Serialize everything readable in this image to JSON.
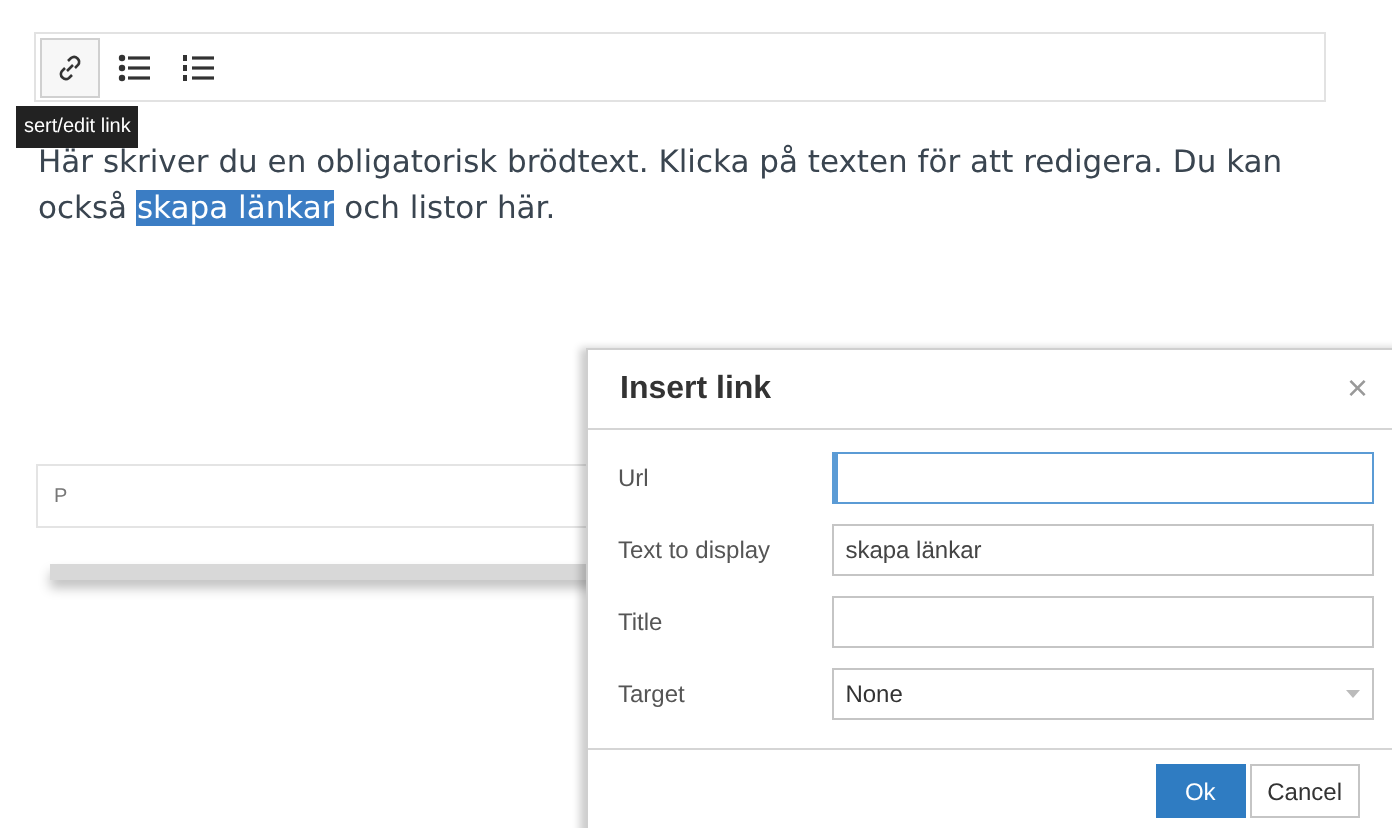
{
  "toolbar": {
    "buttons": [
      {
        "kind": "link",
        "selected": true
      },
      {
        "kind": "bullets",
        "selected": false
      },
      {
        "kind": "numbers",
        "selected": false
      }
    ],
    "tooltip": "sert/edit link"
  },
  "body": {
    "before": "Här skriver du en obligatorisk brödtext. Klicka på texten för att redigera. Du kan också ",
    "selected_text": "skapa länkar",
    "after": " och listor här."
  },
  "status_bar": {
    "path": "P"
  },
  "dialog": {
    "title": "Insert link",
    "close": "×",
    "fields": [
      {
        "label": "Url",
        "kind": "text",
        "focused": true
      },
      {
        "label": "Text to display",
        "kind": "text",
        "value": "skapa länkar",
        "focused": false
      },
      {
        "label": "Title",
        "kind": "text",
        "focused": false
      },
      {
        "label": "Target",
        "kind": "select",
        "value": "None",
        "focused": false
      }
    ],
    "buttons": [
      {
        "label": "Ok",
        "kind": "primary"
      },
      {
        "label": "Cancel",
        "kind": "secondary"
      }
    ]
  }
}
